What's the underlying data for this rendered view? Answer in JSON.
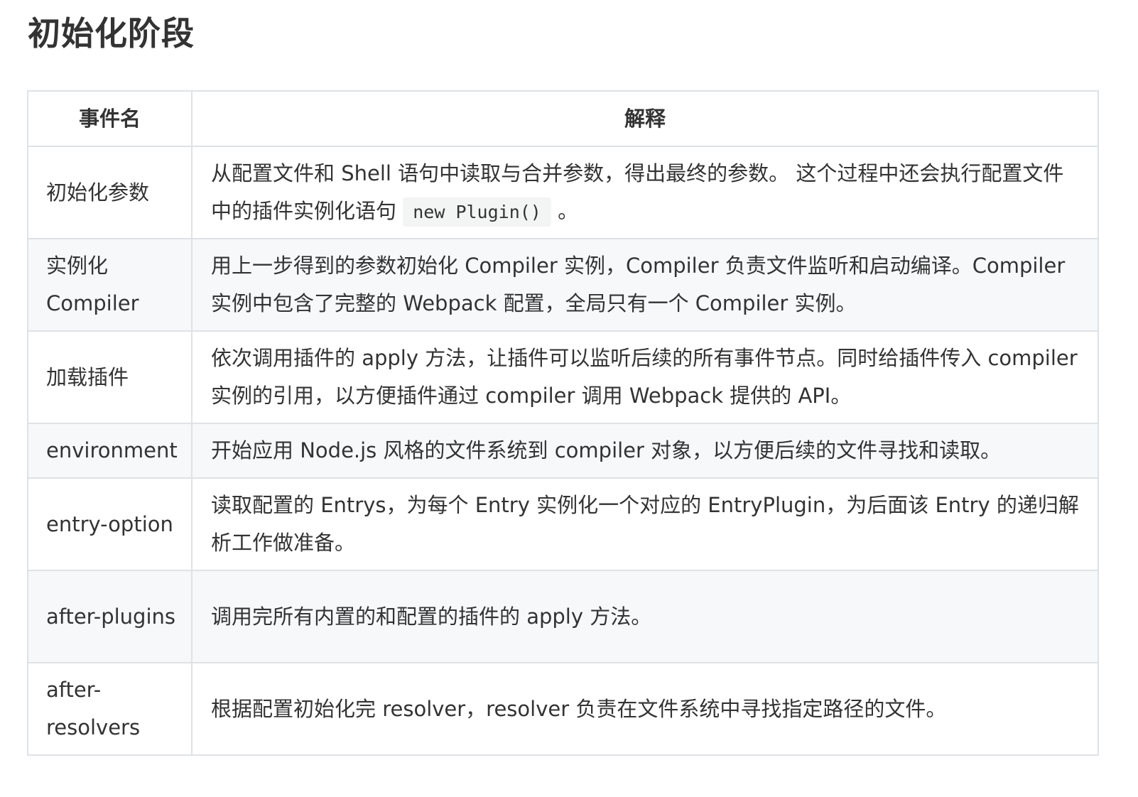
{
  "title": "初始化阶段",
  "table": {
    "headers": [
      "事件名",
      "解释"
    ],
    "rows": [
      {
        "name": "初始化参数",
        "desc": "从配置文件和 Shell 语句中读取与合并参数，得出最终的参数。 这个过程中还会执行配置文件中的插件实例化语句",
        "code": "new Plugin()",
        "desc_after": "。"
      },
      {
        "name": "实例化 Compiler",
        "desc": "用上一步得到的参数初始化 Compiler 实例，Compiler 负责文件监听和启动编译。Compiler 实例中包含了完整的 Webpack 配置，全局只有一个 Compiler 实例。"
      },
      {
        "name": "加载插件",
        "desc": "依次调用插件的 apply 方法，让插件可以监听后续的所有事件节点。同时给插件传入 compiler 实例的引用，以方便插件通过 compiler 调用 Webpack 提供的 API。"
      },
      {
        "name": "environment",
        "desc": "开始应用 Node.js 风格的文件系统到 compiler 对象，以方便后续的文件寻找和读取。"
      },
      {
        "name": "entry-option",
        "desc": "读取配置的 Entrys，为每个 Entry 实例化一个对应的 EntryPlugin，为后面该 Entry 的递归解析工作做准备。"
      },
      {
        "name": "after-plugins",
        "desc": "调用完所有内置的和配置的插件的 apply 方法。"
      },
      {
        "name": "after-resolvers",
        "desc": "根据配置初始化完 resolver，resolver 负责在文件系统中寻找指定路径的文件。"
      }
    ]
  }
}
